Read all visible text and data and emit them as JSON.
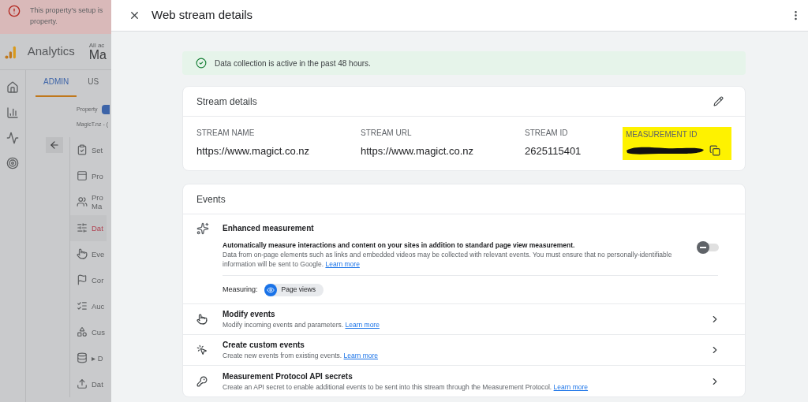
{
  "background": {
    "alert_lines": [
      "This property's setup is",
      "property."
    ],
    "app_name": "Analytics",
    "account_label": "All ac",
    "account_name": "Ma",
    "tabs": [
      {
        "label": "ADMIN",
        "selected": true
      },
      {
        "label": "US",
        "selected": false
      }
    ],
    "property_label": "Property",
    "property_name": "MagicT.nz - (",
    "menu": [
      {
        "label": "Set",
        "selected": false
      },
      {
        "label": "Pro",
        "selected": false
      },
      {
        "label": "Pro Ma",
        "selected": false
      },
      {
        "label": "Dat",
        "selected": true
      },
      {
        "label": "Eve",
        "selected": false
      },
      {
        "label": "Cor",
        "selected": false
      },
      {
        "label": "Auc",
        "selected": false
      },
      {
        "label": "Cus",
        "selected": false
      },
      {
        "label": "▸ D",
        "selected": false
      },
      {
        "label": "Dat",
        "selected": false
      }
    ]
  },
  "drawer": {
    "title": "Web stream details",
    "status": "Data collection is active in the past 48 hours.",
    "stream_details": {
      "title": "Stream details",
      "fields": [
        {
          "label": "STREAM NAME",
          "value": "https://www.magict.co.nz",
          "kind": "text"
        },
        {
          "label": "STREAM URL",
          "value": "https://www.magict.co.nz",
          "kind": "text"
        },
        {
          "label": "STREAM ID",
          "value": "2625115401",
          "kind": "text"
        },
        {
          "label": "MEASUREMENT ID",
          "kind": "redacted",
          "highlighted": true
        }
      ]
    },
    "events": {
      "title": "Events",
      "enhanced": {
        "title": "Enhanced measurement",
        "lead": "Automatically measure interactions and content on your sites in addition to standard page view measurement.",
        "note": "Data from on-page elements such as links and embedded videos may be collected with relevant events. You must ensure that no personally-identifiable information will be sent to Google.",
        "link": "Learn more",
        "on": false,
        "measuring_label": "Measuring:",
        "chips": [
          "Page views"
        ]
      },
      "rows": [
        {
          "title": "Modify events",
          "text": "Modify incoming events and parameters.",
          "link": "Learn more"
        },
        {
          "title": "Create custom events",
          "text": "Create new events from existing events.",
          "link": "Learn more"
        },
        {
          "title": "Measurement Protocol API secrets",
          "text": "Create an API secret to enable additional events to be sent into this stream through the Measurement Protocol.",
          "link": "Learn more"
        }
      ]
    }
  }
}
